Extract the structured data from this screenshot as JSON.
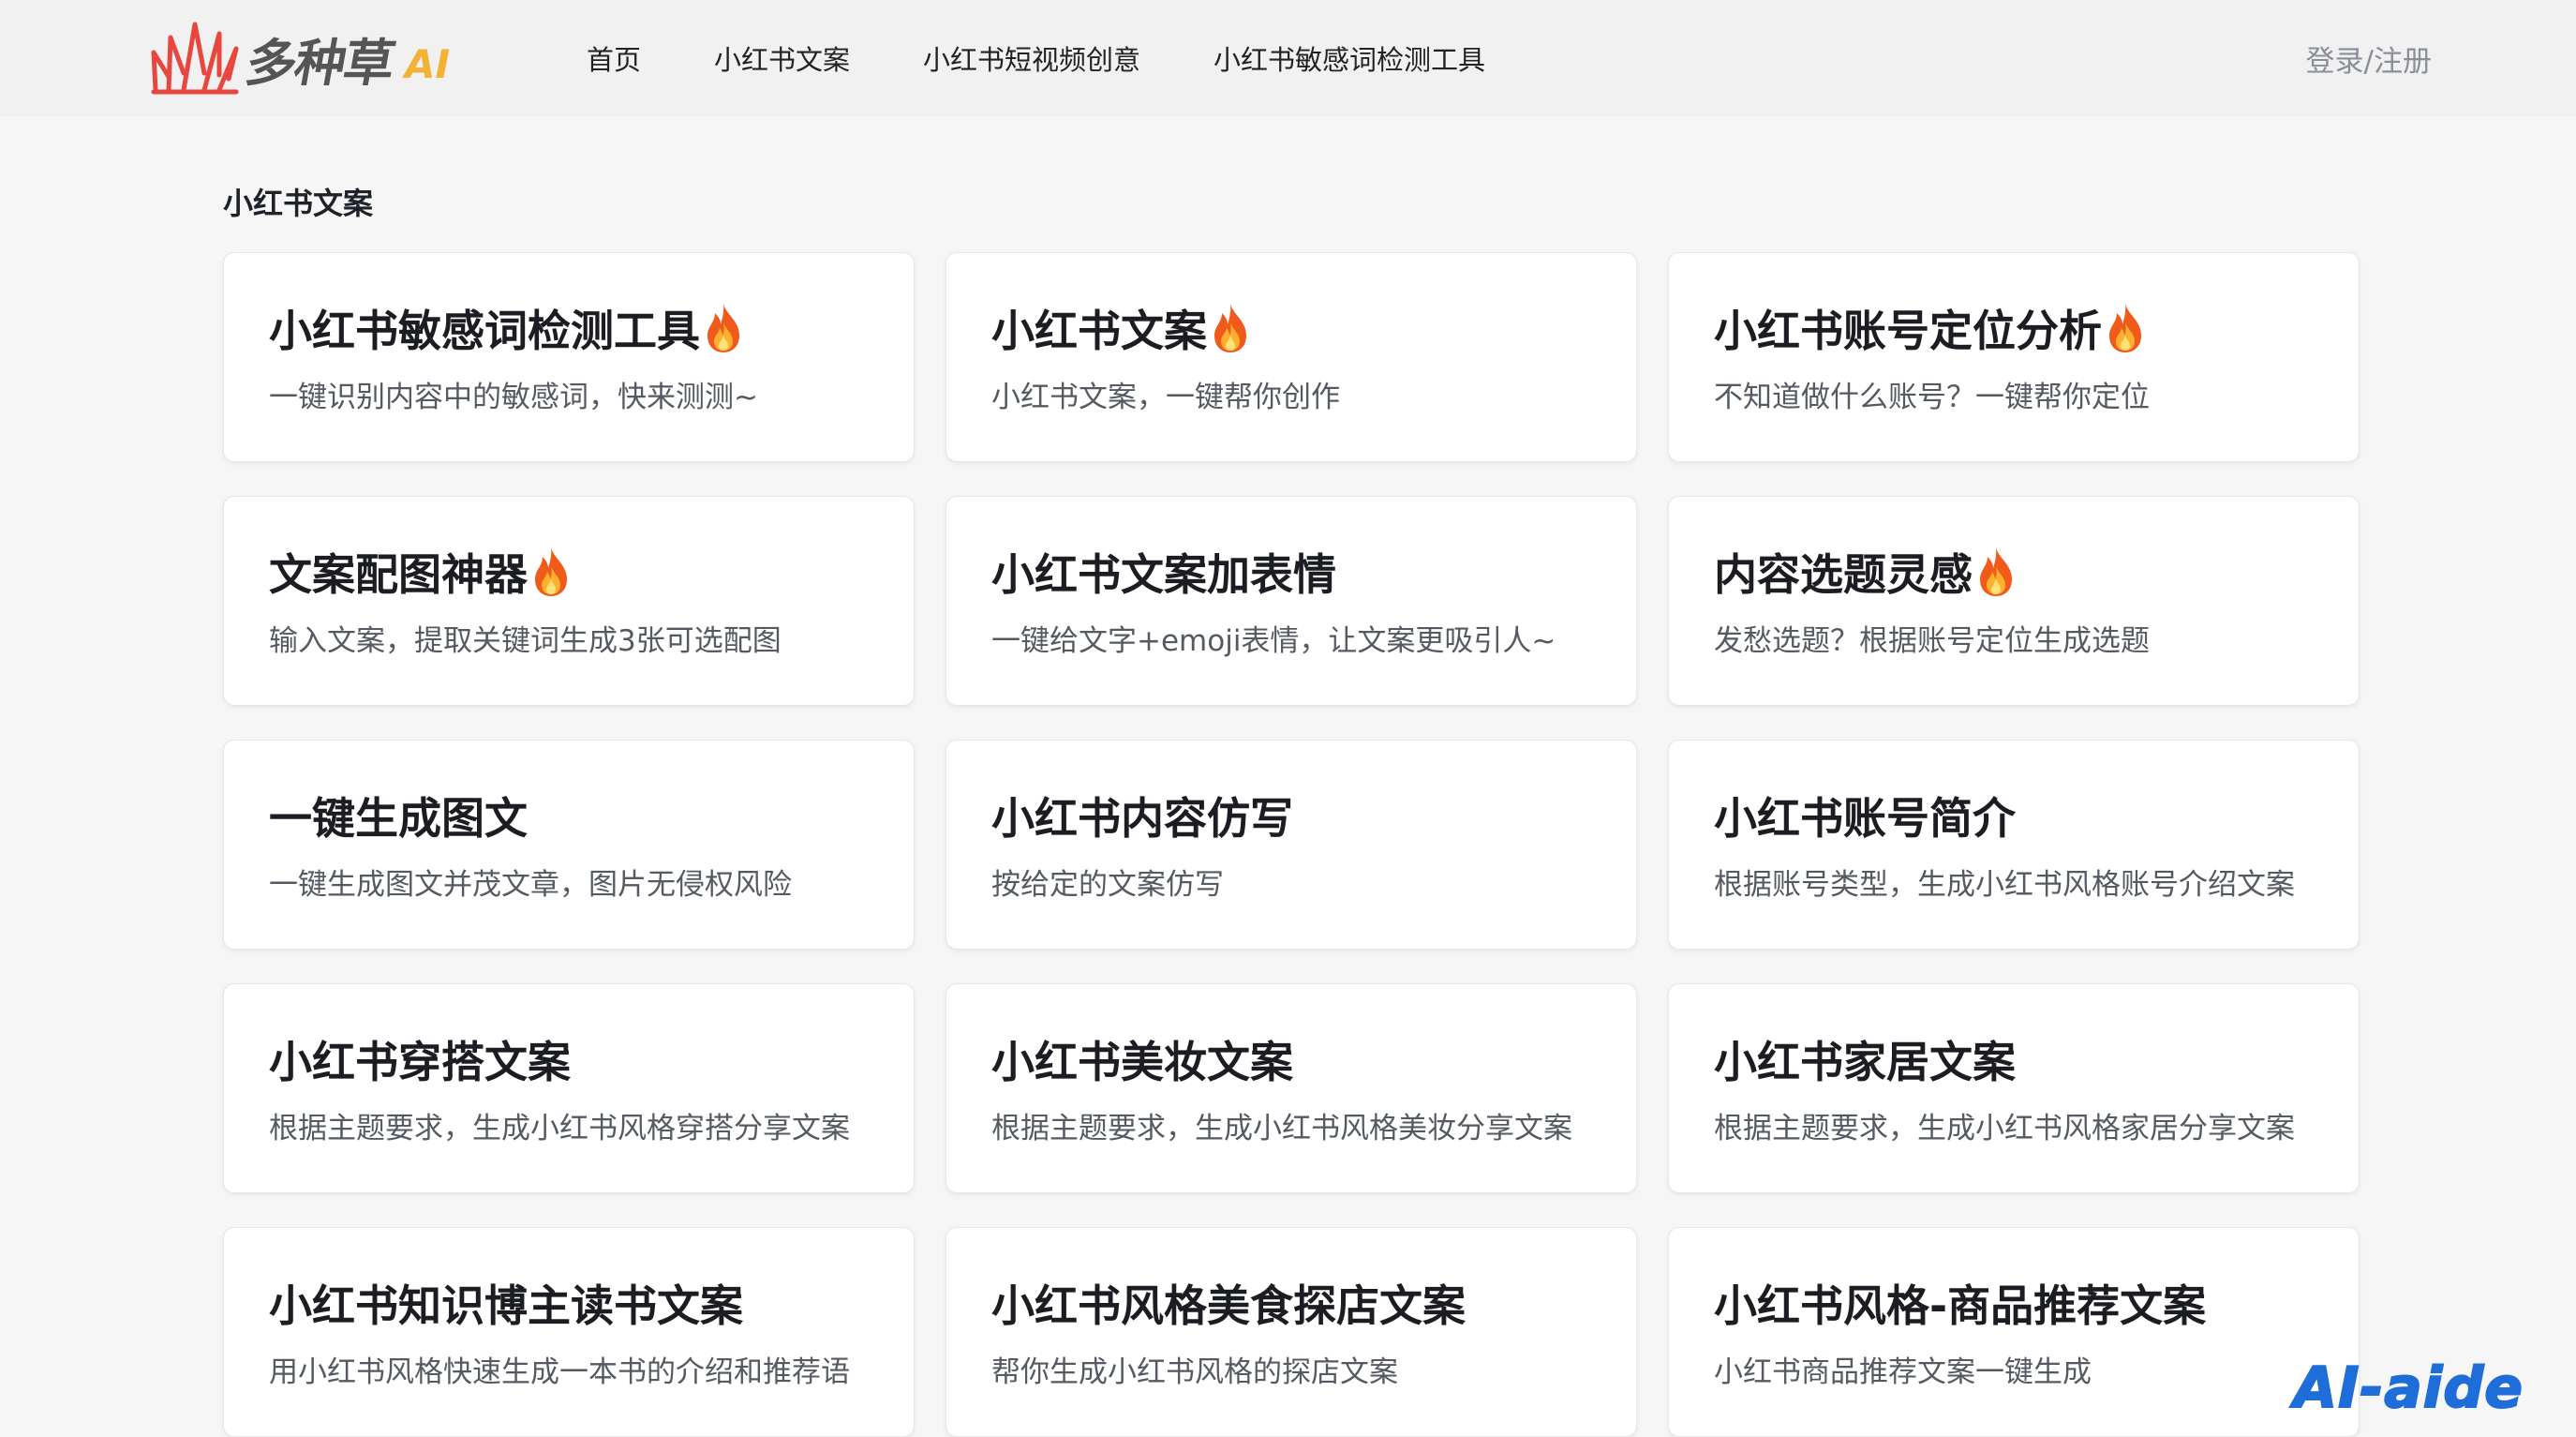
{
  "header": {
    "logo_text": "多种草",
    "logo_ai": "AI",
    "nav": [
      "首页",
      "小红书文案",
      "小红书短视频创意",
      "小红书敏感词检测工具"
    ],
    "login": "登录/注册"
  },
  "section_title": "小红书文案",
  "cards": [
    {
      "title": "小红书敏感词检测工具",
      "desc": "一键识别内容中的敏感词，快来测测~",
      "hot": true
    },
    {
      "title": "小红书文案",
      "desc": "小红书文案，一键帮你创作",
      "hot": true
    },
    {
      "title": "小红书账号定位分析",
      "desc": "不知道做什么账号？一键帮你定位",
      "hot": true
    },
    {
      "title": "文案配图神器",
      "desc": "输入文案，提取关键词生成3张可选配图",
      "hot": true
    },
    {
      "title": "小红书文案加表情",
      "desc": "一键给文字+emoji表情，让文案更吸引人~",
      "hot": false
    },
    {
      "title": "内容选题灵感",
      "desc": "发愁选题？根据账号定位生成选题",
      "hot": true
    },
    {
      "title": "一键生成图文",
      "desc": "一键生成图文并茂文章，图片无侵权风险",
      "hot": false
    },
    {
      "title": "小红书内容仿写",
      "desc": "按给定的文案仿写",
      "hot": false
    },
    {
      "title": "小红书账号简介",
      "desc": "根据账号类型，生成小红书风格账号介绍文案",
      "hot": false
    },
    {
      "title": "小红书穿搭文案",
      "desc": "根据主题要求，生成小红书风格穿搭分享文案",
      "hot": false
    },
    {
      "title": "小红书美妆文案",
      "desc": "根据主题要求，生成小红书风格美妆分享文案",
      "hot": false
    },
    {
      "title": "小红书家居文案",
      "desc": "根据主题要求，生成小红书风格家居分享文案",
      "hot": false
    },
    {
      "title": "小红书知识博主读书文案",
      "desc": "用小红书风格快速生成一本书的介绍和推荐语",
      "hot": false
    },
    {
      "title": "小红书风格美食探店文案",
      "desc": "帮你生成小红书风格的探店文案",
      "hot": false
    },
    {
      "title": "小红书风格-商品推荐文案",
      "desc": "小红书商品推荐文案一键生成",
      "hot": false
    }
  ],
  "watermark": "AI-aide",
  "colors": {
    "logo_red": "#e8473f",
    "logo_ai": "#f2b233",
    "watermark": "#1e6dd8"
  }
}
